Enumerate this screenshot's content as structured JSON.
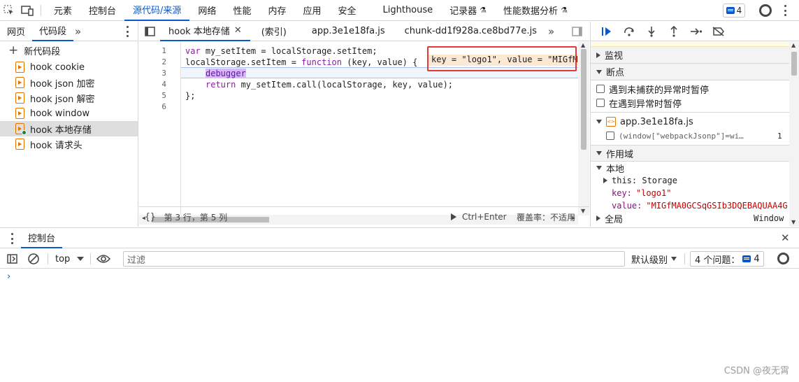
{
  "topbar": {
    "tabs": [
      "元素",
      "控制台",
      "源代码/来源",
      "网络",
      "性能",
      "内存",
      "应用",
      "安全",
      "Lighthouse",
      "记录器",
      "性能数据分析"
    ],
    "active_tab": "源代码/来源",
    "issues_count": "4"
  },
  "navigator": {
    "tabs": [
      "网页",
      "代码段"
    ],
    "active_tab": "代码段",
    "new_snippet_label": "新代码段",
    "snippets": [
      "hook cookie",
      "hook json 加密",
      "hook json 解密",
      "hook window",
      "hook 本地存储",
      "hook 请求头"
    ],
    "selected_snippet": "hook 本地存储"
  },
  "editor": {
    "tabs": [
      "hook 本地存储",
      "(索引)",
      "app.3e1e18fa.js",
      "chunk-dd1f928a.ce8bd77e.js"
    ],
    "active_tab": "hook 本地存储",
    "line_numbers": [
      "1",
      "2",
      "3",
      "4",
      "5",
      "6"
    ],
    "code": {
      "l1_a": "var",
      "l1_b": " my_setItem = localStorage.setItem;",
      "l2_a": "localStorage.setItem = ",
      "l2_b": "function",
      "l2_c": " (key, value) {",
      "l3": "debugger",
      "l4_a": "return",
      "l4_b": " my_setItem.call(localStorage, key, value);",
      "l5": "};",
      "l6": ""
    },
    "inline_value": "key = \"logo1\", value = \"MIGfM",
    "status": {
      "position": "第 3 行，第 5 列",
      "run_shortcut": "Ctrl+Enter",
      "coverage": "覆盖率：不适用"
    }
  },
  "debugger": {
    "sections": {
      "watch": "监视",
      "breakpoints": "断点",
      "scope": "作用域"
    },
    "pause_uncaught": "遇到未捕获的异常时暂停",
    "pause_caught": "在遇到异常时暂停",
    "breakpoint_file": "app.3e1e18fa.js",
    "breakpoint_code": "(window[\"webpackJsonp\"]=wi…",
    "breakpoint_line": "1",
    "scope": {
      "local_label": "本地",
      "this_label": "this: Storage",
      "key_name": "key:",
      "key_value": "\"logo1\"",
      "value_name": "value:",
      "value_value": "\"MIGfMA0GCSqGSIb3DQEBAQUAA4G",
      "global_label": "全局",
      "global_value": "Window"
    }
  },
  "drawer": {
    "tab": "控制台",
    "context": "top",
    "filter_placeholder": "过滤",
    "level": "默认级别",
    "issues_label": "4 个问题：",
    "issues_count": "4"
  },
  "watermark": "CSDN @夜无霄"
}
